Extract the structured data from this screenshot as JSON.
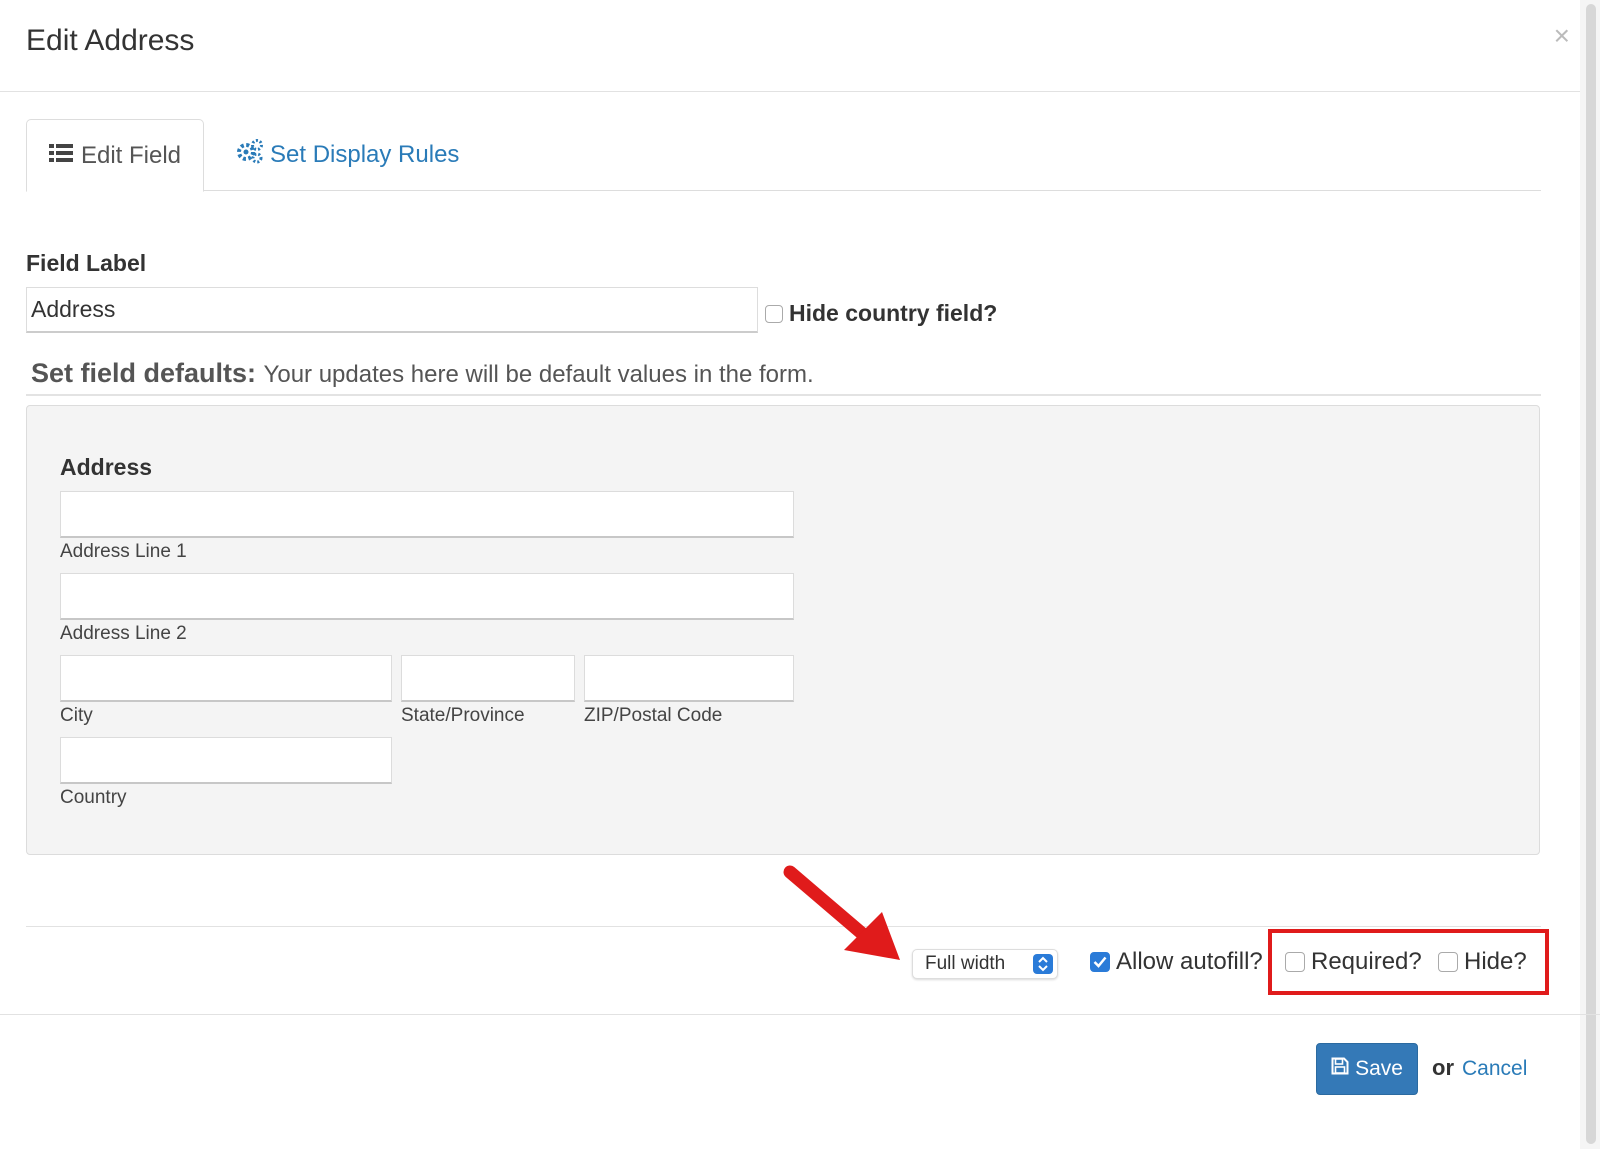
{
  "modal": {
    "title": "Edit Address",
    "close_symbol": "×"
  },
  "tabs": [
    {
      "label": "Edit Field",
      "icon": "list-icon",
      "active": true
    },
    {
      "label": "Set Display Rules",
      "icon": "gears-icon",
      "active": false
    }
  ],
  "field_label": {
    "label": "Field Label",
    "value": "Address",
    "hide_country_label": "Hide country field?",
    "hide_country_checked": false
  },
  "defaults": {
    "title_bold": "Set field defaults:",
    "title_rest": "Your updates here will be default values in the form.",
    "address": {
      "title": "Address",
      "line1_label": "Address Line 1",
      "line2_label": "Address Line 2",
      "city_label": "City",
      "state_label": "State/Province",
      "zip_label": "ZIP/Postal Code",
      "country_label": "Country"
    }
  },
  "footer_options": {
    "width_select": "Full width",
    "allow_autofill_label": "Allow autofill?",
    "allow_autofill_checked": true,
    "required_label": "Required?",
    "required_checked": false,
    "hide_label": "Hide?",
    "hide_checked": false
  },
  "actions": {
    "save_label": "Save",
    "or_text": "or",
    "cancel_label": "Cancel"
  },
  "colors": {
    "accent": "#3479b7",
    "link": "#2a7bb8",
    "annotation": "#e01b1b"
  }
}
